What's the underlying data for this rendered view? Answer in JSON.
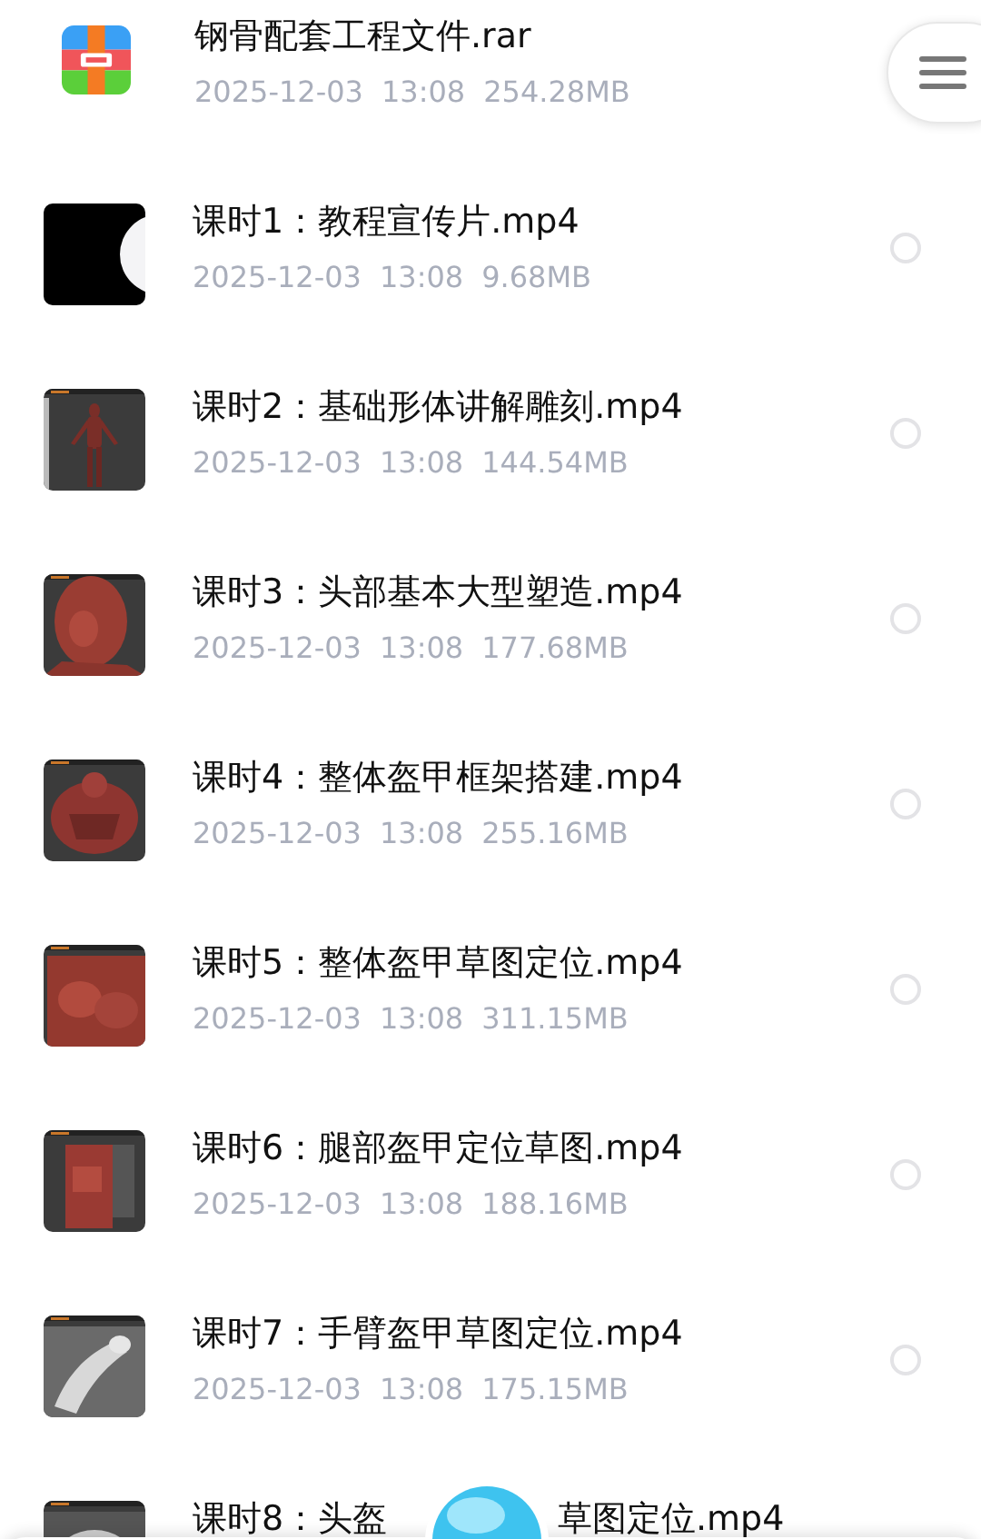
{
  "files": [
    {
      "kind": "archive",
      "title": [
        "钢骨配套工程文件.rar"
      ],
      "date": "2025-12-03",
      "time": "13:08",
      "size": "254.28MB"
    },
    {
      "kind": "video",
      "title": [
        "课时1：教程宣传片.mp4"
      ],
      "date": "2025-12-03",
      "time": "13:08",
      "size": "9.68MB",
      "selected": false
    },
    {
      "kind": "video",
      "title": [
        "课时2：基础形体讲解雕刻.mp4"
      ],
      "date": "2025-12-03",
      "time": "13:08",
      "size": "144.54MB",
      "selected": false
    },
    {
      "kind": "video",
      "title": [
        "课时3：头部基本大型塑造.mp4"
      ],
      "date": "2025-12-03",
      "time": "13:08",
      "size": "177.68MB",
      "selected": false
    },
    {
      "kind": "video",
      "title": [
        "课时4：整体盔甲框架搭建.mp4"
      ],
      "date": "2025-12-03",
      "time": "13:08",
      "size": "255.16MB",
      "selected": false
    },
    {
      "kind": "video",
      "title": [
        "课时5：整体盔甲草图定位.mp4"
      ],
      "date": "2025-12-03",
      "time": "13:08",
      "size": "311.15MB",
      "selected": false
    },
    {
      "kind": "video",
      "title": [
        "课时6：腿部盔甲定位草图.mp4"
      ],
      "date": "2025-12-03",
      "time": "13:08",
      "size": "188.16MB",
      "selected": false
    },
    {
      "kind": "video",
      "title": [
        "课时7：手臂盔甲草图定位.mp4"
      ],
      "date": "2025-12-03",
      "time": "13:08",
      "size": "175.15MB",
      "selected": false
    },
    {
      "kind": "video",
      "title": [
        "课时8：头盔",
        "草图定位.mp4"
      ]
    }
  ]
}
